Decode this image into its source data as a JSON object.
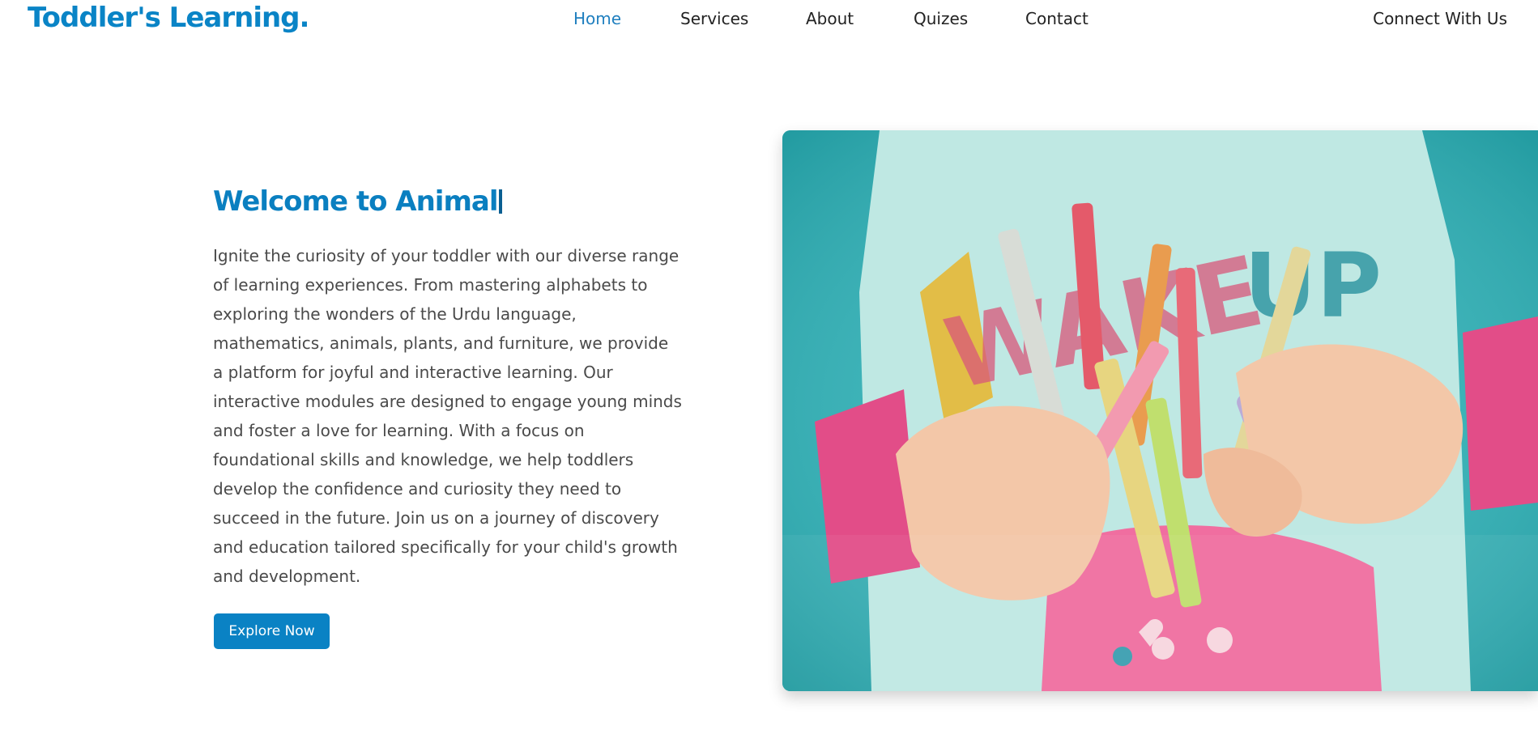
{
  "header": {
    "logo": "Toddler's Learning.",
    "nav": [
      {
        "label": "Home",
        "active": true
      },
      {
        "label": "Services",
        "active": false
      },
      {
        "label": "About",
        "active": false
      },
      {
        "label": "Quizes",
        "active": false
      },
      {
        "label": "Contact",
        "active": false
      }
    ],
    "connect_label": "Connect With Us"
  },
  "hero": {
    "title": "Welcome to Animal",
    "description": "Ignite the curiosity of your toddler with our diverse range of learning experiences. From mastering alphabets to exploring the wonders of the Urdu language, mathematics, animals, plants, and furniture, we provide a platform for joyful and interactive learning. Our interactive modules are designed to engage young minds and foster a love for learning. With a focus on foundational skills and knowledge, we help toddlers develop the confidence and curiosity they need to succeed in the future. Join us on a journey of discovery and education tailored specifically for your child's growth and development.",
    "button_label": "Explore Now"
  },
  "colors": {
    "brand_blue": "#0a84c6",
    "nav_active": "#1f7fbf",
    "text_dark": "#222222",
    "text_body": "#4a4a4a"
  }
}
